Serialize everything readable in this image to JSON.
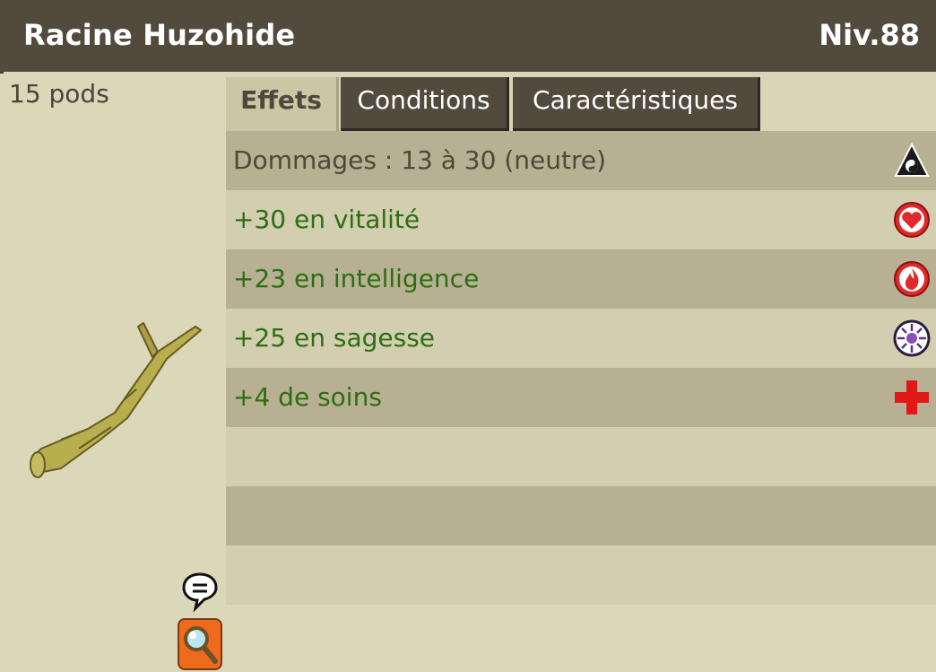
{
  "item": {
    "name": "Racine Huzohide",
    "level": "Niv.88",
    "weight": "15 pods"
  },
  "tabs": [
    {
      "label": "Effets",
      "active": true
    },
    {
      "label": "Conditions",
      "active": false
    },
    {
      "label": "Caractéristiques",
      "active": false
    }
  ],
  "effects": [
    {
      "text": "Dommages : 13 à 30 (neutre)",
      "icon": "neutral-element-icon"
    },
    {
      "text": "+30 en vitalité",
      "icon": "vitality-heart-icon"
    },
    {
      "text": "+23 en intelligence",
      "icon": "intelligence-fire-icon"
    },
    {
      "text": "+25 en sagesse",
      "icon": "wisdom-icon"
    },
    {
      "text": "+4 de soins",
      "icon": "heal-cross-icon"
    }
  ],
  "colors": {
    "header": "#514a3d",
    "panel": "#dbd7b9",
    "row_dark": "#b8b093",
    "row_light": "#d3ceb0",
    "effect_text": "#2c6e12"
  }
}
